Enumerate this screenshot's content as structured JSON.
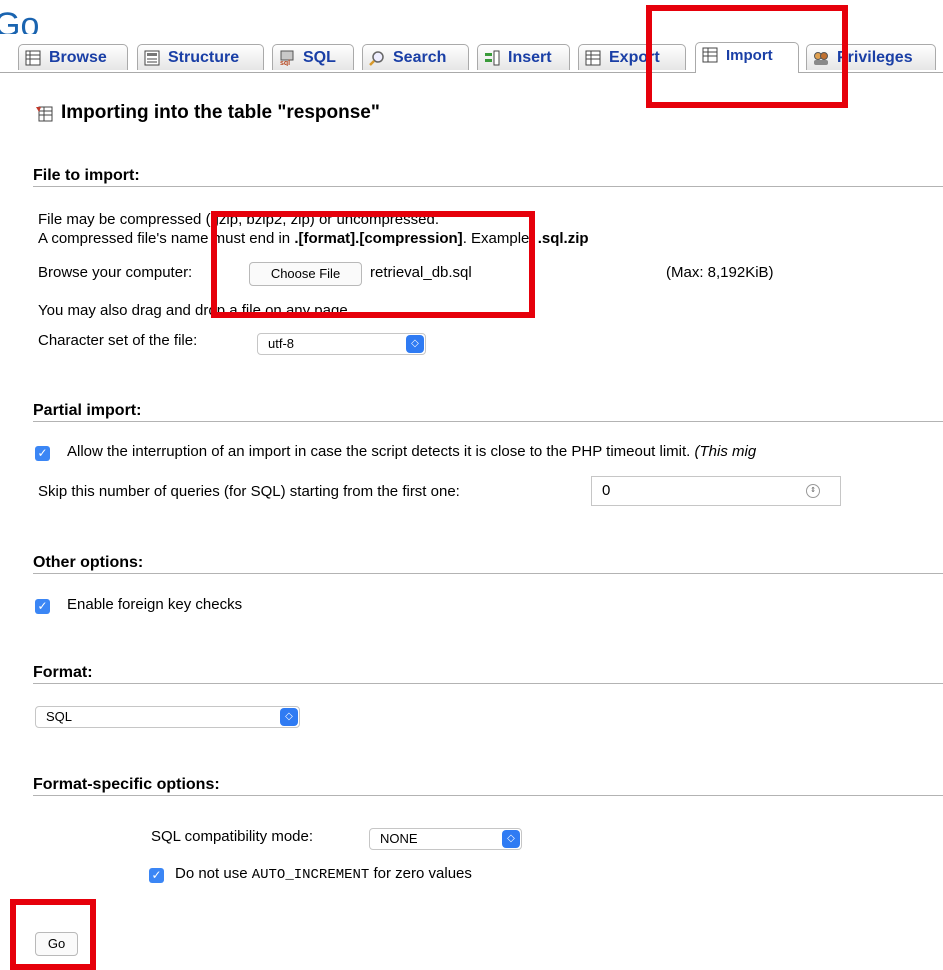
{
  "header": {
    "go_partial": "Go"
  },
  "tabs": [
    {
      "label": "Browse",
      "icon": "browse-icon"
    },
    {
      "label": "Structure",
      "icon": "structure-icon"
    },
    {
      "label": "SQL",
      "icon": "sql-icon"
    },
    {
      "label": "Search",
      "icon": "search-icon"
    },
    {
      "label": "Insert",
      "icon": "insert-icon"
    },
    {
      "label": "Export",
      "icon": "export-icon"
    },
    {
      "label": "Import",
      "icon": "import-icon",
      "active": true
    },
    {
      "label": "Privileges",
      "icon": "privileges-icon"
    }
  ],
  "page": {
    "title": "Importing into the table \"response\""
  },
  "file_import": {
    "legend": "File to import:",
    "line1": "File may be compressed (gzip, bzip2, zip) or uncompressed.",
    "line2_prefix": "A compressed file's name must end in ",
    "line2_format": ".[format].[compression]",
    "line2_mid": ". Example: ",
    "line2_example": ".sql.zip",
    "browse_label": "Browse your computer:",
    "choose_button": "Choose File",
    "file_name": "retrieval_db.sql",
    "max_size": "(Max: 8,192KiB)",
    "drag_hint": "You may also drag and drop a file on any page.",
    "charset_label": "Character set of the file:",
    "charset_value": "utf-8"
  },
  "partial_import": {
    "legend": "Partial import:",
    "allow_interrupt": "Allow the interruption of an import in case the script detects it is close to the PHP timeout limit.",
    "allow_interrupt_note": "(This mig",
    "skip_label": "Skip this number of queries (for SQL) starting from the first one:",
    "skip_value": "0"
  },
  "other_options": {
    "legend": "Other options:",
    "foreign_keys": "Enable foreign key checks"
  },
  "format": {
    "legend": "Format:",
    "value": "SQL"
  },
  "format_specific": {
    "legend": "Format-specific options:",
    "compat_label": "SQL compatibility mode:",
    "compat_value": "NONE",
    "no_auto_prefix": "Do not use ",
    "no_auto_code": "AUTO_INCREMENT",
    "no_auto_suffix": " for zero values"
  },
  "actions": {
    "go_label": "Go"
  },
  "colors": {
    "highlight": "#e6000b",
    "link": "#1a3fa6",
    "accent": "#3b86f5"
  }
}
